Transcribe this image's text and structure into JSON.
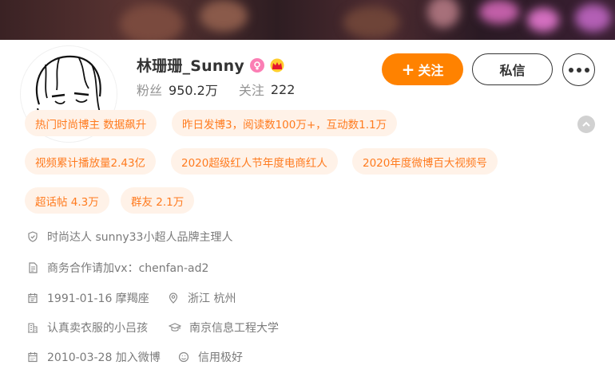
{
  "profile": {
    "name": "林珊珊_Sunny",
    "verified_mark": "V",
    "stats": {
      "fans_label": "粉丝",
      "fans_value": "950.2万",
      "following_label": "关注",
      "following_value": "222"
    }
  },
  "actions": {
    "follow_plus": "+",
    "follow_label": "关注",
    "message_label": "私信"
  },
  "tags": [
    "热门时尚博主 数据飙升",
    "昨日发博3，阅读数100万+，互动数1.1万",
    "视频累计播放量2.43亿",
    "2020超级红人节年度电商红人",
    "2020年度微博百大视频号",
    "超话帖 4.3万",
    "群友 2.1万"
  ],
  "info": [
    {
      "icon": "shield-icon",
      "text": "时尚达人 sunny33小超人品牌主理人"
    },
    {
      "icon": "document-icon",
      "text": "商务合作请加vx：chenfan-ad2"
    },
    {
      "icon": "calendar-icon",
      "text": "1991-01-16 摩羯座"
    },
    {
      "icon": "location-icon",
      "text": "浙江 杭州"
    },
    {
      "icon": "building-icon",
      "text": "认真卖衣服的小吕孩"
    },
    {
      "icon": "graduation-cap-icon",
      "text": "南京信息工程大学"
    },
    {
      "icon": "calendar-icon",
      "text": "2010-03-28 加入微博"
    },
    {
      "icon": "credit-icon",
      "text": "信用极好"
    }
  ],
  "colors": {
    "accent": "#ff8200",
    "tag_bg": "#fff2e8",
    "tag_text": "#ff7b1f",
    "female_icon": "#fb7eb4",
    "verified_red": "#e6162d"
  }
}
